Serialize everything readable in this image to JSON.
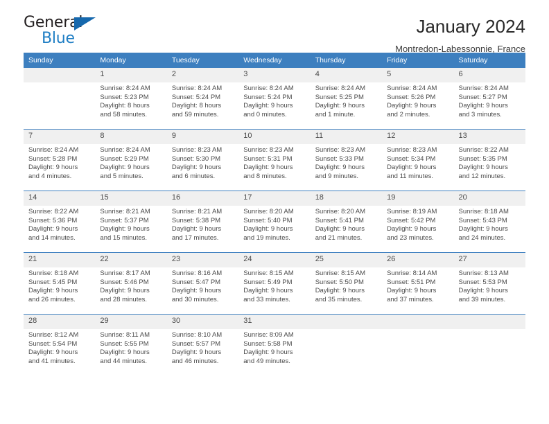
{
  "logo": {
    "word1": "General",
    "word2": "Blue",
    "triangle_icon": "triangle-icon",
    "color_dark": "#231f20",
    "color_blue": "#1f7ec4"
  },
  "header": {
    "title": "January 2024",
    "subtitle": "Montredon-Labessonnie, France"
  },
  "colors": {
    "header_blue": "#3d7fbf",
    "daynum_bg": "#f0f0f0",
    "text": "#4a4a4a"
  },
  "calendar": {
    "weekday_headers": [
      "Sunday",
      "Monday",
      "Tuesday",
      "Wednesday",
      "Thursday",
      "Friday",
      "Saturday"
    ],
    "weeks": [
      [
        {
          "day": "",
          "lines": []
        },
        {
          "day": "1",
          "lines": [
            "Sunrise: 8:24 AM",
            "Sunset: 5:23 PM",
            "Daylight: 8 hours",
            "and 58 minutes."
          ]
        },
        {
          "day": "2",
          "lines": [
            "Sunrise: 8:24 AM",
            "Sunset: 5:24 PM",
            "Daylight: 8 hours",
            "and 59 minutes."
          ]
        },
        {
          "day": "3",
          "lines": [
            "Sunrise: 8:24 AM",
            "Sunset: 5:24 PM",
            "Daylight: 9 hours",
            "and 0 minutes."
          ]
        },
        {
          "day": "4",
          "lines": [
            "Sunrise: 8:24 AM",
            "Sunset: 5:25 PM",
            "Daylight: 9 hours",
            "and 1 minute."
          ]
        },
        {
          "day": "5",
          "lines": [
            "Sunrise: 8:24 AM",
            "Sunset: 5:26 PM",
            "Daylight: 9 hours",
            "and 2 minutes."
          ]
        },
        {
          "day": "6",
          "lines": [
            "Sunrise: 8:24 AM",
            "Sunset: 5:27 PM",
            "Daylight: 9 hours",
            "and 3 minutes."
          ]
        }
      ],
      [
        {
          "day": "7",
          "lines": [
            "Sunrise: 8:24 AM",
            "Sunset: 5:28 PM",
            "Daylight: 9 hours",
            "and 4 minutes."
          ]
        },
        {
          "day": "8",
          "lines": [
            "Sunrise: 8:24 AM",
            "Sunset: 5:29 PM",
            "Daylight: 9 hours",
            "and 5 minutes."
          ]
        },
        {
          "day": "9",
          "lines": [
            "Sunrise: 8:23 AM",
            "Sunset: 5:30 PM",
            "Daylight: 9 hours",
            "and 6 minutes."
          ]
        },
        {
          "day": "10",
          "lines": [
            "Sunrise: 8:23 AM",
            "Sunset: 5:31 PM",
            "Daylight: 9 hours",
            "and 8 minutes."
          ]
        },
        {
          "day": "11",
          "lines": [
            "Sunrise: 8:23 AM",
            "Sunset: 5:33 PM",
            "Daylight: 9 hours",
            "and 9 minutes."
          ]
        },
        {
          "day": "12",
          "lines": [
            "Sunrise: 8:23 AM",
            "Sunset: 5:34 PM",
            "Daylight: 9 hours",
            "and 11 minutes."
          ]
        },
        {
          "day": "13",
          "lines": [
            "Sunrise: 8:22 AM",
            "Sunset: 5:35 PM",
            "Daylight: 9 hours",
            "and 12 minutes."
          ]
        }
      ],
      [
        {
          "day": "14",
          "lines": [
            "Sunrise: 8:22 AM",
            "Sunset: 5:36 PM",
            "Daylight: 9 hours",
            "and 14 minutes."
          ]
        },
        {
          "day": "15",
          "lines": [
            "Sunrise: 8:21 AM",
            "Sunset: 5:37 PM",
            "Daylight: 9 hours",
            "and 15 minutes."
          ]
        },
        {
          "day": "16",
          "lines": [
            "Sunrise: 8:21 AM",
            "Sunset: 5:38 PM",
            "Daylight: 9 hours",
            "and 17 minutes."
          ]
        },
        {
          "day": "17",
          "lines": [
            "Sunrise: 8:20 AM",
            "Sunset: 5:40 PM",
            "Daylight: 9 hours",
            "and 19 minutes."
          ]
        },
        {
          "day": "18",
          "lines": [
            "Sunrise: 8:20 AM",
            "Sunset: 5:41 PM",
            "Daylight: 9 hours",
            "and 21 minutes."
          ]
        },
        {
          "day": "19",
          "lines": [
            "Sunrise: 8:19 AM",
            "Sunset: 5:42 PM",
            "Daylight: 9 hours",
            "and 23 minutes."
          ]
        },
        {
          "day": "20",
          "lines": [
            "Sunrise: 8:18 AM",
            "Sunset: 5:43 PM",
            "Daylight: 9 hours",
            "and 24 minutes."
          ]
        }
      ],
      [
        {
          "day": "21",
          "lines": [
            "Sunrise: 8:18 AM",
            "Sunset: 5:45 PM",
            "Daylight: 9 hours",
            "and 26 minutes."
          ]
        },
        {
          "day": "22",
          "lines": [
            "Sunrise: 8:17 AM",
            "Sunset: 5:46 PM",
            "Daylight: 9 hours",
            "and 28 minutes."
          ]
        },
        {
          "day": "23",
          "lines": [
            "Sunrise: 8:16 AM",
            "Sunset: 5:47 PM",
            "Daylight: 9 hours",
            "and 30 minutes."
          ]
        },
        {
          "day": "24",
          "lines": [
            "Sunrise: 8:15 AM",
            "Sunset: 5:49 PM",
            "Daylight: 9 hours",
            "and 33 minutes."
          ]
        },
        {
          "day": "25",
          "lines": [
            "Sunrise: 8:15 AM",
            "Sunset: 5:50 PM",
            "Daylight: 9 hours",
            "and 35 minutes."
          ]
        },
        {
          "day": "26",
          "lines": [
            "Sunrise: 8:14 AM",
            "Sunset: 5:51 PM",
            "Daylight: 9 hours",
            "and 37 minutes."
          ]
        },
        {
          "day": "27",
          "lines": [
            "Sunrise: 8:13 AM",
            "Sunset: 5:53 PM",
            "Daylight: 9 hours",
            "and 39 minutes."
          ]
        }
      ],
      [
        {
          "day": "28",
          "lines": [
            "Sunrise: 8:12 AM",
            "Sunset: 5:54 PM",
            "Daylight: 9 hours",
            "and 41 minutes."
          ]
        },
        {
          "day": "29",
          "lines": [
            "Sunrise: 8:11 AM",
            "Sunset: 5:55 PM",
            "Daylight: 9 hours",
            "and 44 minutes."
          ]
        },
        {
          "day": "30",
          "lines": [
            "Sunrise: 8:10 AM",
            "Sunset: 5:57 PM",
            "Daylight: 9 hours",
            "and 46 minutes."
          ]
        },
        {
          "day": "31",
          "lines": [
            "Sunrise: 8:09 AM",
            "Sunset: 5:58 PM",
            "Daylight: 9 hours",
            "and 49 minutes."
          ]
        },
        {
          "day": "",
          "lines": []
        },
        {
          "day": "",
          "lines": []
        },
        {
          "day": "",
          "lines": []
        }
      ]
    ]
  }
}
